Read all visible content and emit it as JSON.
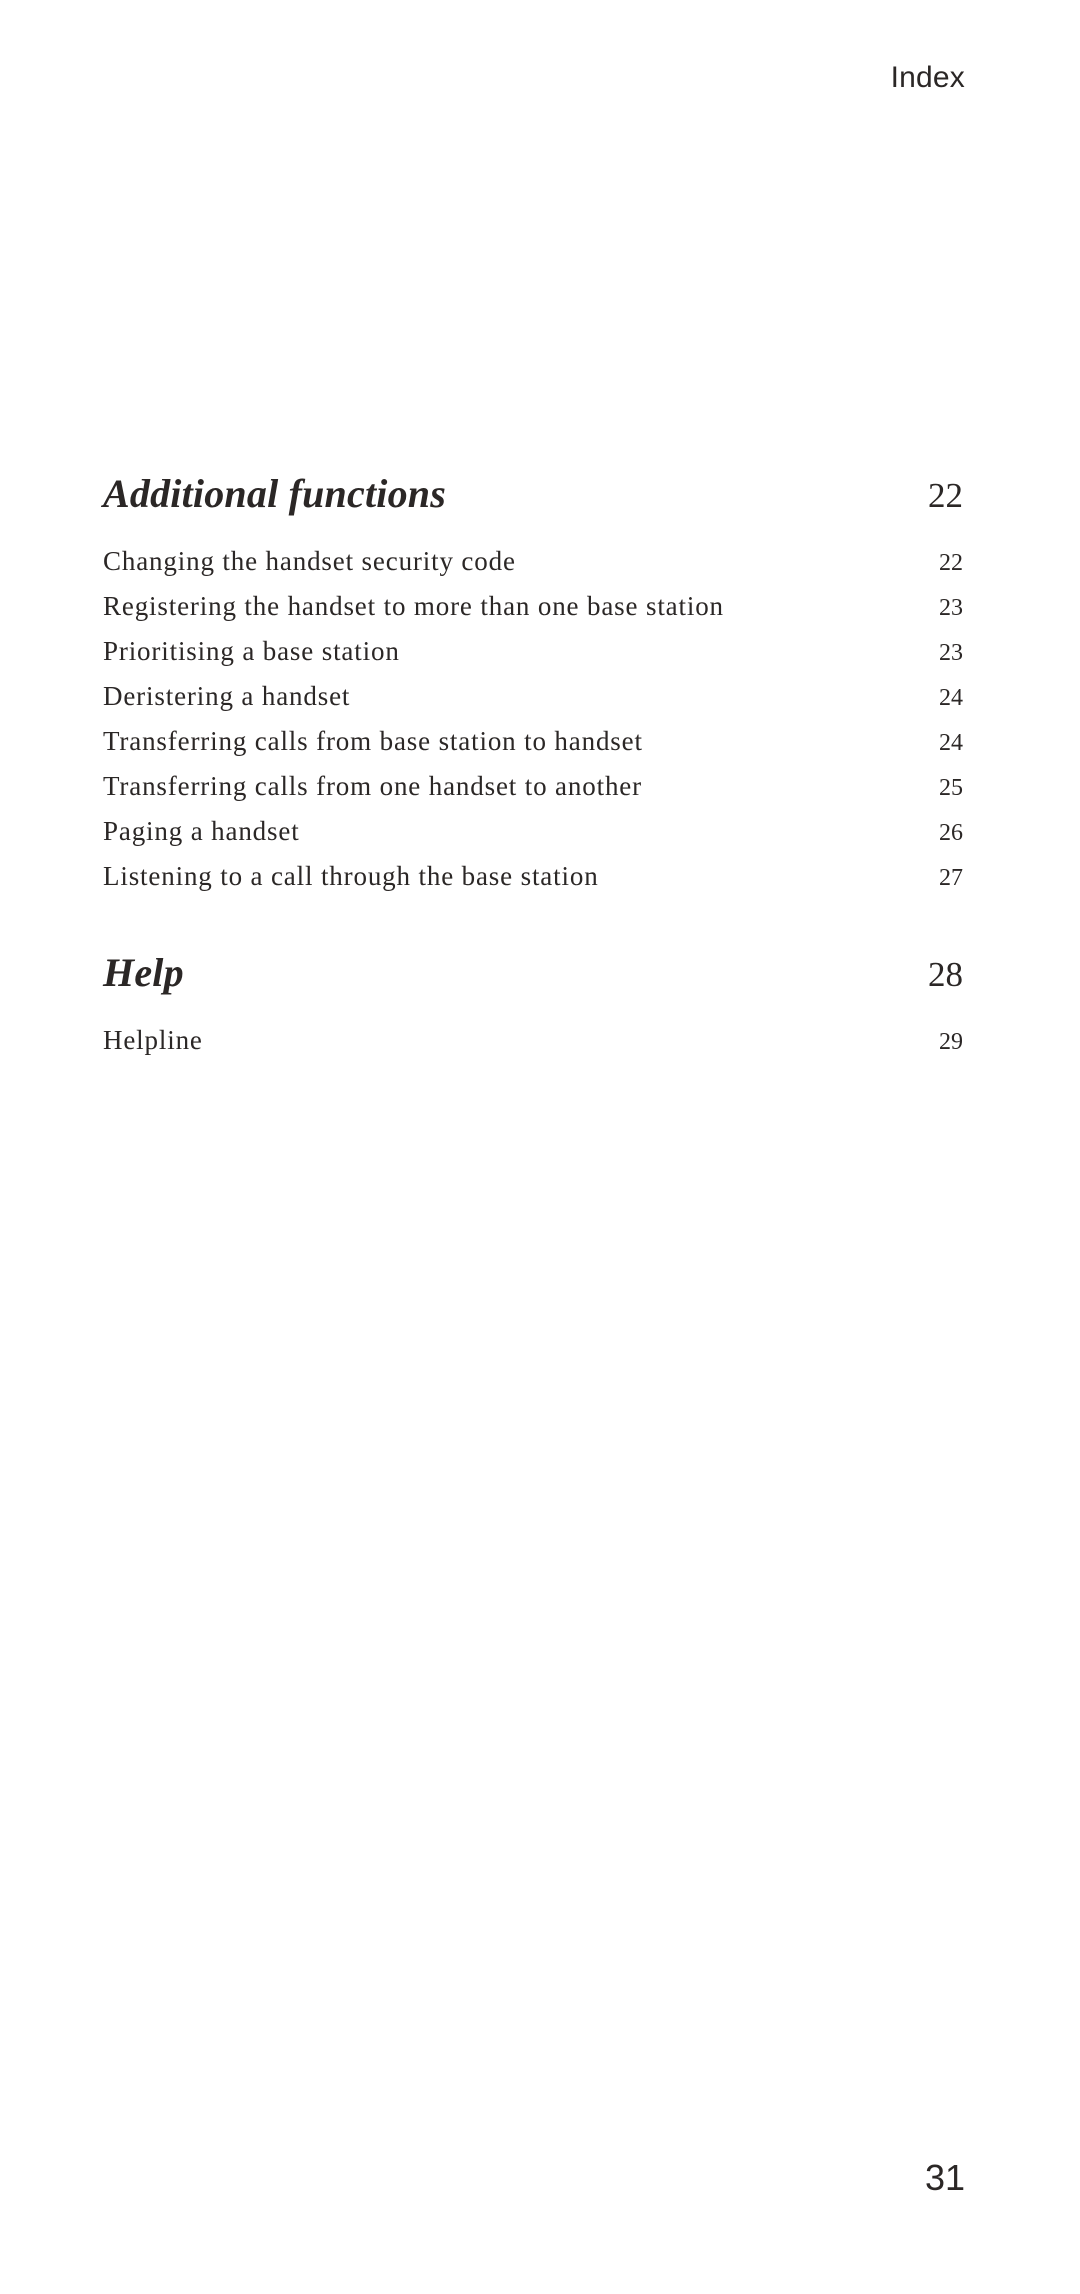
{
  "page": {
    "background_color": "#ffffff",
    "text_color": "#2b2726",
    "running_header": "Index",
    "folio": "31"
  },
  "toc": {
    "sections": [
      {
        "title": "Additional functions",
        "page": "22",
        "entries": [
          {
            "title": "Changing the handset security code",
            "page": "22"
          },
          {
            "title": "Registering the handset to more than one base station",
            "page": "23"
          },
          {
            "title": "Prioritising a base station",
            "page": "23"
          },
          {
            "title": "Deristering a handset",
            "page": "24"
          },
          {
            "title": "Transferring calls from base station to handset",
            "page": "24"
          },
          {
            "title": "Transferring calls from one handset to another",
            "page": "25"
          },
          {
            "title": "Paging a handset",
            "page": "26"
          },
          {
            "title": "Listening to a call through the base station",
            "page": "27"
          }
        ]
      },
      {
        "title": "Help",
        "page": "28",
        "entries": [
          {
            "title": "Helpline",
            "page": "29"
          }
        ]
      }
    ]
  }
}
